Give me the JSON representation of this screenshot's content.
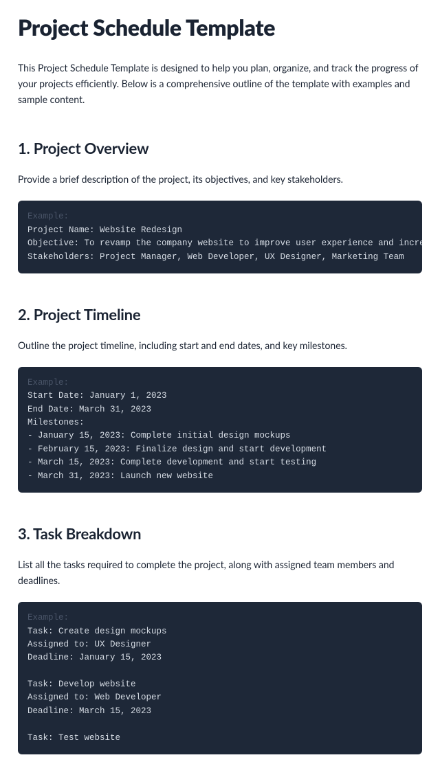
{
  "title": "Project Schedule Template",
  "intro": "This Project Schedule Template is designed to help you plan, organize, and track the progress of your projects efficiently. Below is a comprehensive outline of the template with examples and sample content.",
  "sections": {
    "overview": {
      "heading": "1. Project Overview",
      "desc": "Provide a brief description of the project, its objectives, and key stakeholders.",
      "example_label": "Example:",
      "example_body": "Project Name: Website Redesign\nObjective: To revamp the company website to improve user experience and increase engagement.\nStakeholders: Project Manager, Web Developer, UX Designer, Marketing Team"
    },
    "timeline": {
      "heading": "2. Project Timeline",
      "desc": "Outline the project timeline, including start and end dates, and key milestones.",
      "example_label": "Example:",
      "example_body": "Start Date: January 1, 2023\nEnd Date: March 31, 2023\nMilestones:\n- January 15, 2023: Complete initial design mockups\n- February 15, 2023: Finalize design and start development\n- March 15, 2023: Complete development and start testing\n- March 31, 2023: Launch new website"
    },
    "tasks": {
      "heading": "3. Task Breakdown",
      "desc": "List all the tasks required to complete the project, along with assigned team members and deadlines.",
      "example_label": "Example:",
      "example_body": "Task: Create design mockups\nAssigned to: UX Designer\nDeadline: January 15, 2023\n\nTask: Develop website\nAssigned to: Web Developer\nDeadline: March 15, 2023\n\nTask: Test website"
    }
  }
}
